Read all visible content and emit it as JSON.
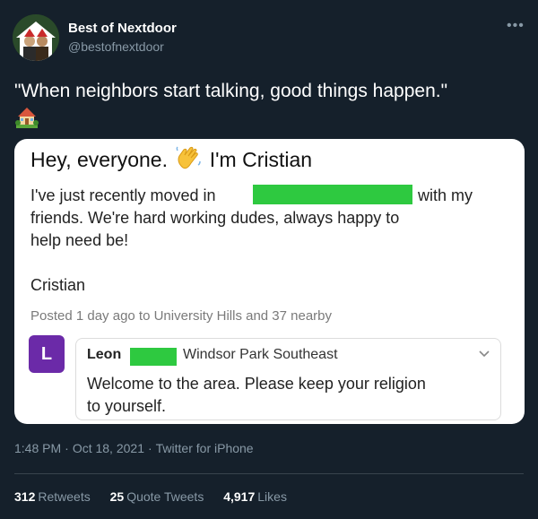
{
  "author": {
    "display_name": "Best of Nextdoor",
    "handle": "@bestofnextdoor"
  },
  "tweet": {
    "text": "\"When neighbors start talking, good things happen.\"",
    "emoji": "house-with-garden",
    "timestamp": "1:48 PM",
    "date": "Oct 18, 2021",
    "source": "Twitter for iPhone"
  },
  "embedded_post": {
    "title_part1": "Hey, everyone.",
    "title_part2": "I'm Cristian",
    "line1_start": "I've just recently moved in",
    "line1_end": "with my",
    "line2": "friends.  We're hard working dudes, always happy to",
    "line3": "help need be!",
    "signature": "Cristian",
    "posted": "Posted 1 day ago to University Hills and 37 nearby",
    "reply": {
      "avatar_letter": "L",
      "name": "Leon",
      "area": "Windsor Park Southeast",
      "line1": "Welcome to the area. Please keep your religion",
      "line2": "to yourself."
    }
  },
  "stats": {
    "retweets_count": "312",
    "retweets_label": "Retweets",
    "quotes_count": "25",
    "quotes_label": "Quote Tweets",
    "likes_count": "4,917",
    "likes_label": "Likes"
  },
  "colors": {
    "background": "#15202b",
    "secondary_text": "#8899a6",
    "redaction": "#2ec940",
    "reply_avatar": "#6b2aa8"
  }
}
